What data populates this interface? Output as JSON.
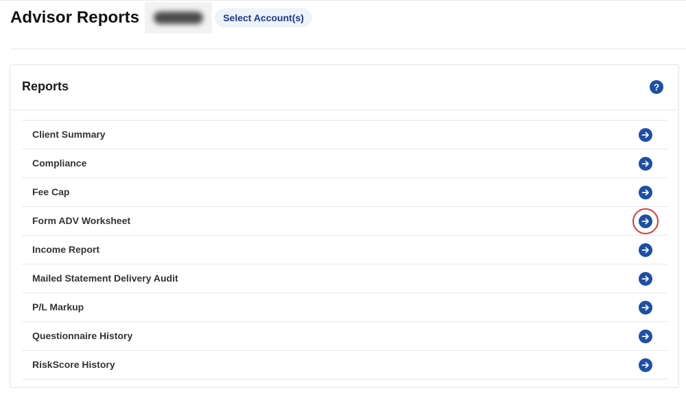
{
  "header": {
    "title": "Advisor Reports",
    "select_accounts_label": "Select Account(s)"
  },
  "card": {
    "title": "Reports",
    "help_icon": "question-circle-icon",
    "help_glyph": "?"
  },
  "reports": [
    {
      "label": "Client Summary",
      "icon": "arrow-right-circle-icon"
    },
    {
      "label": "Compliance",
      "icon": "arrow-right-circle-icon"
    },
    {
      "label": "Fee Cap",
      "icon": "arrow-right-circle-icon"
    },
    {
      "label": "Form ADV Worksheet",
      "icon": "arrow-right-circle-icon",
      "highlighted": true
    },
    {
      "label": "Income Report",
      "icon": "arrow-right-circle-icon"
    },
    {
      "label": "Mailed Statement Delivery Audit",
      "icon": "arrow-right-circle-icon"
    },
    {
      "label": "P/L Markup",
      "icon": "arrow-right-circle-icon"
    },
    {
      "label": "Questionnaire History",
      "icon": "arrow-right-circle-icon"
    },
    {
      "label": "RiskScore History",
      "icon": "arrow-right-circle-icon"
    }
  ],
  "colors": {
    "accent": "#1d4fa6",
    "select_text": "#17378a",
    "select_bg": "#eef2f9",
    "highlight": "#d63a3a"
  }
}
